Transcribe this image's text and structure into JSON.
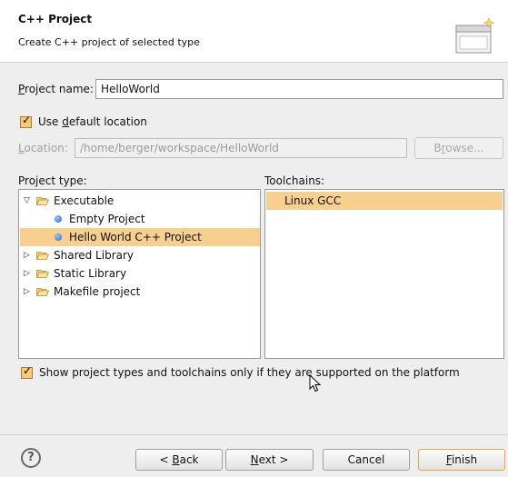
{
  "header": {
    "title": "C++ Project",
    "description": "Create C++ project of selected type"
  },
  "project_name": {
    "label_pre": "",
    "label_mnemonic": "P",
    "label_post": "roject name:",
    "value": "HelloWorld"
  },
  "use_default_location": {
    "label_pre": "Use ",
    "label_mnemonic": "d",
    "label_post": "efault location",
    "checked": true
  },
  "location": {
    "label_mnemonic": "L",
    "label_post": "ocation:",
    "value": "/home/berger/workspace/HelloWorld",
    "browse_pre": "B",
    "browse_mnemonic": "r",
    "browse_post": "owse..."
  },
  "project_type": {
    "label": "Project type:",
    "items": [
      {
        "label": "Executable",
        "kind": "folder",
        "expanded": true,
        "level": 0
      },
      {
        "label": "Empty Project",
        "kind": "leaf",
        "level": 1
      },
      {
        "label": "Hello World C++ Project",
        "kind": "leaf",
        "level": 1,
        "selected": true
      },
      {
        "label": "Shared Library",
        "kind": "folder",
        "expanded": false,
        "level": 0
      },
      {
        "label": "Static Library",
        "kind": "folder",
        "expanded": false,
        "level": 0
      },
      {
        "label": "Makefile project",
        "kind": "folder",
        "expanded": false,
        "level": 0
      }
    ]
  },
  "toolchains": {
    "label": "Toolchains:",
    "items": [
      {
        "label": "Linux GCC",
        "selected": true
      }
    ]
  },
  "show_supported": {
    "label": "Show project types and toolchains only if they are supported on the platform",
    "checked": true
  },
  "buttons": {
    "help": "?",
    "back_pre": "< ",
    "back_mnemonic": "B",
    "back_post": "ack",
    "next_mnemonic": "N",
    "next_post": "ext >",
    "cancel": "Cancel",
    "finish_mnemonic": "F",
    "finish_post": "inish"
  },
  "colors": {
    "selection": "#f7cf8e",
    "accent": "#e8a54a"
  }
}
